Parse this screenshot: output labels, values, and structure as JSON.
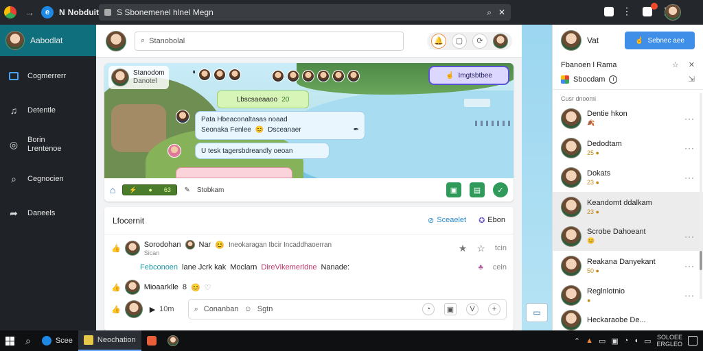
{
  "browser": {
    "tab_label": "Nobduit",
    "url": "S Sbonemenel hlnel Megn"
  },
  "leftnav": {
    "profile_name": "Aabodlat",
    "items": [
      {
        "label": "Cogmerrerr",
        "icon": "layout-icon"
      },
      {
        "label": "Detentle",
        "icon": "music-note-icon"
      },
      {
        "label": "Borin",
        "label2": "Lrentenoe",
        "icon": "compass-icon"
      },
      {
        "label": "Cegnocien",
        "icon": "search-icon"
      },
      {
        "label": "Daneels",
        "icon": "share-icon"
      }
    ]
  },
  "main": {
    "search_placeholder": "Stanobolal",
    "game": {
      "player_name": "Stanodom",
      "player_sub": "Danotel",
      "top_pill": "Imgtsbtbee",
      "green_bubble": "Lbscsaeaaoo",
      "green_bubble_num": "20",
      "blue_bubble_1_line1": "Pata  Hbeaconaltasas noaad",
      "blue_bubble_1_line2": "Seonaka Fenlee",
      "blue_bubble_1_line2b": "Dsceanaer",
      "blue_bubble_2": "U tesk tagersbdreandly oeoan",
      "toolbar_progress_num": "63",
      "toolbar_label": "Stobkam"
    },
    "feed": {
      "title": "Lfocernit",
      "link_1": "Sceaelet",
      "link_2": "Ebon",
      "post_1": {
        "author": "Sorodohan",
        "author2": "Nar",
        "text": "Ineokaragan Ibcir Incaddhaoerran",
        "sub": "Sican",
        "right_text": "tcin"
      },
      "post_1_body": {
        "c1": "Febconoen",
        "c2": "lane Jcrk kak",
        "c3": "Moclarn",
        "c4": "DireVikemerldne",
        "c5": "Nanade:"
      },
      "post_1_body_right": "cein",
      "post_2": {
        "author": "Mioaarklle",
        "num": "8"
      },
      "comment_time": "10m",
      "comment_placeholder": "Conanban",
      "comment_placeholder2": "Sgtn"
    }
  },
  "rightpanel": {
    "user": "Vat",
    "share_label": "Sebnec aee",
    "section_title": "Fbanoen l Rama",
    "status_label": "Sbocdam",
    "group_label": "Cusr dnoomi",
    "friends": [
      {
        "name": "Dentie hkon",
        "emoji": "🍂",
        "hl": false
      },
      {
        "name": "Dedodtam",
        "emoji": "25 ●",
        "hl": false
      },
      {
        "name": "Dokats",
        "emoji": "23 ●",
        "hl": false
      },
      {
        "name": "Keandomt ddalkam",
        "emoji": "23 ●",
        "hl": true
      },
      {
        "name": "Scrobe Dahoeant",
        "emoji": "😊",
        "hl": true
      },
      {
        "name": "Reakana Danyekant",
        "emoji": "50 ●",
        "hl": false
      },
      {
        "name": "Reglnlotnio",
        "emoji": "●",
        "hl": false
      },
      {
        "name": "Heckaraobe De...",
        "emoji": "",
        "hl": false
      }
    ]
  },
  "taskbar": {
    "app_1": "Scee",
    "app_2": "Neochation",
    "clock_line1": "SOLOEE",
    "clock_line2": "ERGLEO"
  }
}
